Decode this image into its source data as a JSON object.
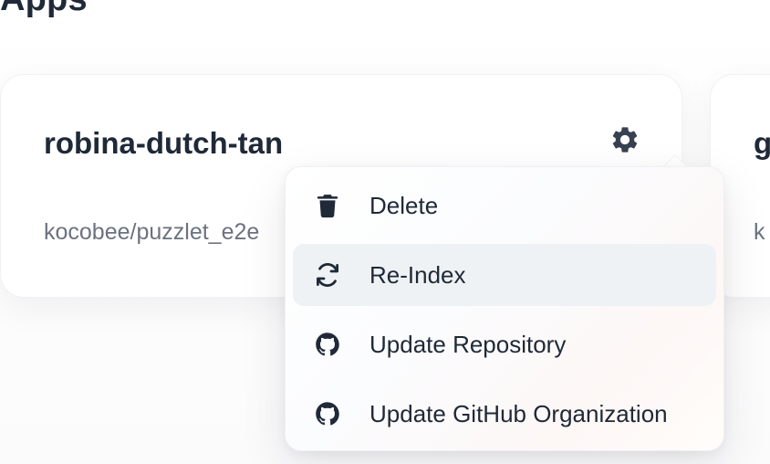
{
  "page": {
    "heading": "Apps"
  },
  "cards": [
    {
      "title": "robina-dutch-tan",
      "subtitle": "kocobee/puzzlet_e2e"
    },
    {
      "title": "g",
      "subtitle": "k"
    }
  ],
  "settings_button": {
    "icon": "gear-icon"
  },
  "menu": {
    "items": [
      {
        "label": "Delete",
        "icon": "trash-icon",
        "active": false
      },
      {
        "label": "Re-Index",
        "icon": "refresh-icon",
        "active": true
      },
      {
        "label": "Update Repository",
        "icon": "github-icon",
        "active": false
      },
      {
        "label": "Update GitHub Organization",
        "icon": "github-icon",
        "active": false
      }
    ]
  },
  "colors": {
    "text": "#1f2937",
    "muted": "#6b7280",
    "active_bg": "#eff2f5",
    "icon": "#374151"
  }
}
